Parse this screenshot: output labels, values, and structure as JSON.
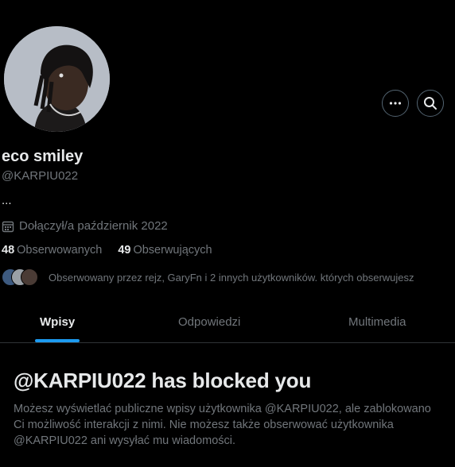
{
  "profile": {
    "display_name": "eco smiley",
    "handle": "@KARPIU022",
    "bio": "...",
    "joined": "Dołączył/a październik 2022",
    "following_count": "48",
    "following_label": "Obserwowanych",
    "followers_count": "49",
    "followers_label": "Obserwujących",
    "followed_by_text": "Obserwowany przez rejz, GaryFn i 2 innych użytkowników. których obserwujesz"
  },
  "tabs": [
    {
      "label": "Wpisy",
      "active": true
    },
    {
      "label": "Odpowiedzi",
      "active": false
    },
    {
      "label": "Multimedia",
      "active": false
    }
  ],
  "blocked": {
    "title": "@KARPIU022 has blocked you",
    "message": "Możesz wyświetlać publiczne wpisy użytkownika @KARPIU022, ale zablokowano Ci możliwość interakcji z nimi. Nie możesz także obserwować użytkownika @KARPIU022 ani wysyłać mu wiadomości."
  },
  "icons": {
    "more": "more-icon",
    "search": "search-icon",
    "calendar": "calendar-icon"
  },
  "colors": {
    "background": "#000000",
    "text_primary": "#e7e9ea",
    "text_secondary": "#71767b",
    "accent": "#1d9bf0",
    "border": "#2f3336"
  }
}
